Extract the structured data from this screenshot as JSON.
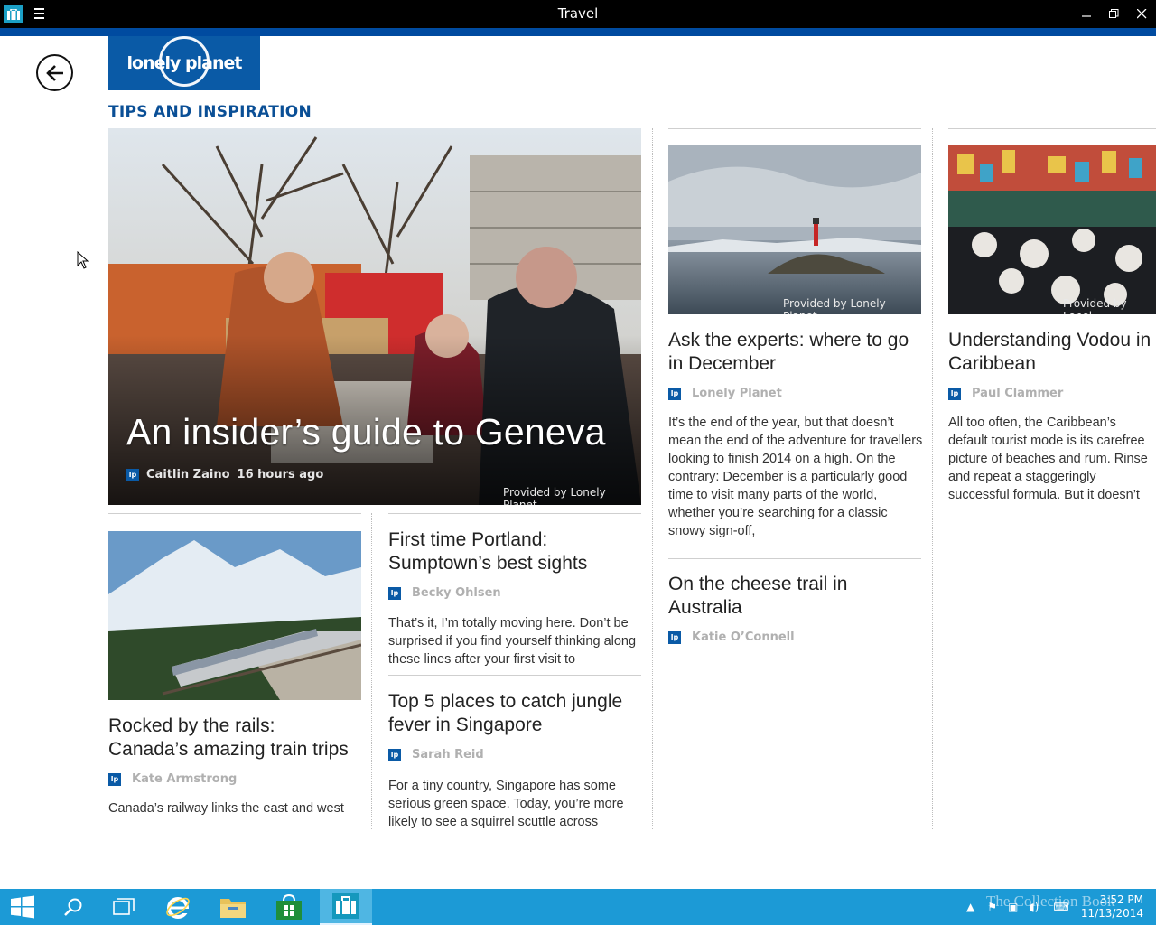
{
  "window": {
    "title": "Travel",
    "controls": [
      "minimize",
      "restore",
      "close"
    ]
  },
  "logo": {
    "text": "lonely planet"
  },
  "section": {
    "title": "TIPS AND INSPIRATION"
  },
  "hero": {
    "title": "An insider’s guide to Geneva",
    "author": "Caitlin Zaino",
    "time": "16 hours ago",
    "provided": "Provided by Lonely Planet",
    "badge": "lp"
  },
  "articles": {
    "december": {
      "title_line1": "Ask the experts: where to go",
      "title_line2": "in December",
      "author": "Lonely Planet",
      "provided": "Provided by Lonely Planet",
      "snippet": "It’s the end of the year, but that doesn’t mean the end of the adventure for travellers looking to finish 2014 on a high. On the contrary: December is a particularly good time to visit many parts of the world, whether you’re searching for a classic snowy sign-off,"
    },
    "vodou": {
      "title_line1": "Understanding Vodou in",
      "title_line2": "Caribbean",
      "author": "Paul Clammer",
      "provided": "Provided by Lonel",
      "snippet": "All too often, the Caribbean’s default tourist mode is its carefree picture of beaches and rum. Rinse and repeat a staggeringly successful formula. But it doesn’t leave much scope to get to"
    },
    "train": {
      "title_line1": "Rocked by the rails:",
      "title_line2": "Canada’s amazing train trips",
      "author": "Kate Armstrong",
      "snippet": "Canada’s railway links the east and west"
    },
    "portland": {
      "title_line1": "First time Portland:",
      "title_line2": "Sumptown’s best sights",
      "author": "Becky Ohlsen",
      "snippet": "That’s it, I’m totally moving here. Don’t be surprised if you find yourself thinking along these lines after your first visit to"
    },
    "singapore": {
      "title_line1": "Top 5 places to catch jungle",
      "title_line2": "fever in Singapore",
      "author": "Sarah Reid",
      "snippet": "For a tiny country, Singapore has some serious green space. Today, you’re more likely to see a squirrel scuttle across"
    },
    "cheese": {
      "title_line1": "On the cheese trail in",
      "title_line2": "Australia",
      "author": "Katie O’Connell"
    }
  },
  "taskbar": {
    "items": [
      "start-icon",
      "search-icon",
      "task-view-icon",
      "internet-explorer-icon",
      "file-explorer-icon",
      "store-icon",
      "travel-app-icon"
    ],
    "time": "3:52 PM",
    "date": "11/13/2014",
    "watermark": "The Collection Book"
  },
  "colors": {
    "titlebar": "#000000",
    "accent": "#004ba0",
    "section_title": "#0a4f96",
    "taskbar": "#1c9ad6"
  }
}
